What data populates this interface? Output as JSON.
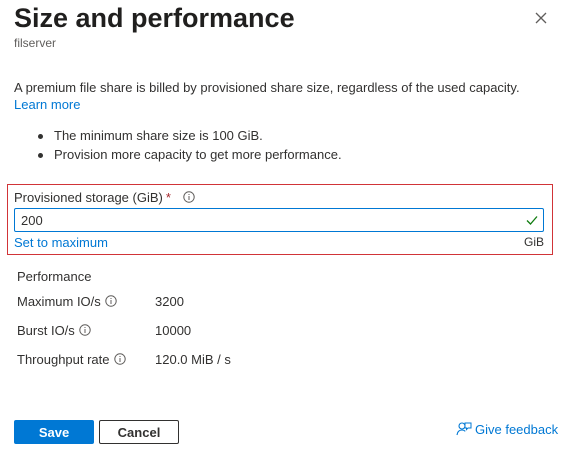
{
  "header": {
    "title": "Size and performance",
    "subtitle": "filserver"
  },
  "description": {
    "text": "A premium file share is billed by provisioned share size, regardless of the used capacity.",
    "learn_more": "Learn more"
  },
  "bullets": [
    "The minimum share size is 100 GiB.",
    "Provision more capacity to get more performance."
  ],
  "storage": {
    "label": "Provisioned storage (GiB)",
    "required_mark": "*",
    "value": "200",
    "set_to_maximum": "Set to maximum",
    "unit": "GiB"
  },
  "performance": {
    "heading": "Performance",
    "rows": [
      {
        "label": "Maximum IO/s",
        "value": "3200"
      },
      {
        "label": "Burst IO/s",
        "value": "10000"
      },
      {
        "label": "Throughput rate",
        "value": "120.0 MiB / s"
      }
    ]
  },
  "footer": {
    "save_label": "Save",
    "cancel_label": "Cancel",
    "feedback_label": "Give feedback"
  },
  "colors": {
    "accent": "#0078d4",
    "highlight_border": "#d13438",
    "success": "#107c10"
  },
  "icons": {
    "close": "close-icon",
    "info": "info-icon",
    "check": "check-icon",
    "feedback": "feedback-icon"
  }
}
